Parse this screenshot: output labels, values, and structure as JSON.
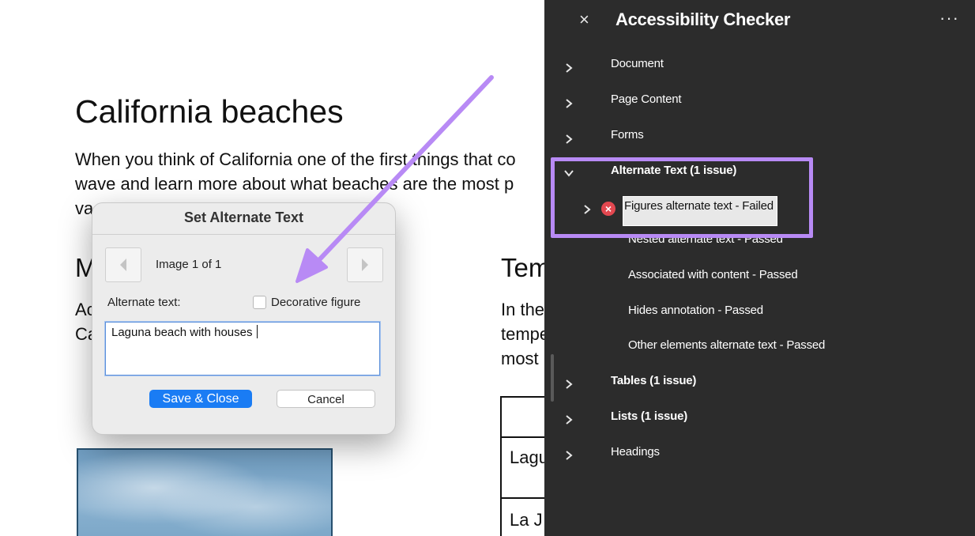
{
  "document": {
    "title": "California beaches",
    "intro_line1": "When you think of California one of the first things that co",
    "intro_line2": "wave and learn more about what beaches are the most p",
    "intro_line3": "va",
    "heading_left_partial": "M",
    "para_left_line1": "Ac",
    "para_left_line2": "Ca",
    "heading_right_partial": "Tem",
    "para_right_line1": "In the",
    "para_right_line2": "tempe",
    "para_right_line3": "most",
    "table_cell1": "Lagu",
    "table_cell2": "La J"
  },
  "dialog": {
    "title": "Set Alternate Text",
    "prev_icon": "chevron-left-icon",
    "next_icon": "chevron-right-icon",
    "image_counter": "Image 1 of 1",
    "alt_text_label": "Alternate text:",
    "decorative_label": "Decorative figure",
    "decorative_checked": false,
    "alt_text_value": "Laguna beach with houses ",
    "save_label": "Save & Close",
    "cancel_label": "Cancel",
    "primary_color": "#1a7cf4"
  },
  "annotation": {
    "arrow_color": "#b88af5",
    "highlight_color": "#b88af5"
  },
  "panel": {
    "close_icon": "×",
    "title": "Accessibility Checker",
    "more_icon": "···",
    "background": "#2c2c2c",
    "sections": [
      {
        "label": "Document",
        "expanded": false
      },
      {
        "label": "Page Content",
        "expanded": false
      },
      {
        "label": "Forms",
        "expanded": false
      },
      {
        "label": "Alternate Text (1 issue)",
        "expanded": true
      },
      {
        "label": "Tables (1 issue)",
        "expanded": false
      },
      {
        "label": "Lists (1 issue)",
        "expanded": false
      },
      {
        "label": "Headings",
        "expanded": false
      }
    ],
    "alt_text_rules": [
      {
        "label": "Figures alternate text - Failed",
        "status": "failed"
      },
      {
        "label": "Nested alternate text - Passed",
        "status": "passed"
      },
      {
        "label": "Associated with content - Passed",
        "status": "passed"
      },
      {
        "label": "Hides annotation - Passed",
        "status": "passed"
      },
      {
        "label": "Other elements alternate text - Passed",
        "status": "passed"
      }
    ],
    "fail_icon": "×"
  }
}
